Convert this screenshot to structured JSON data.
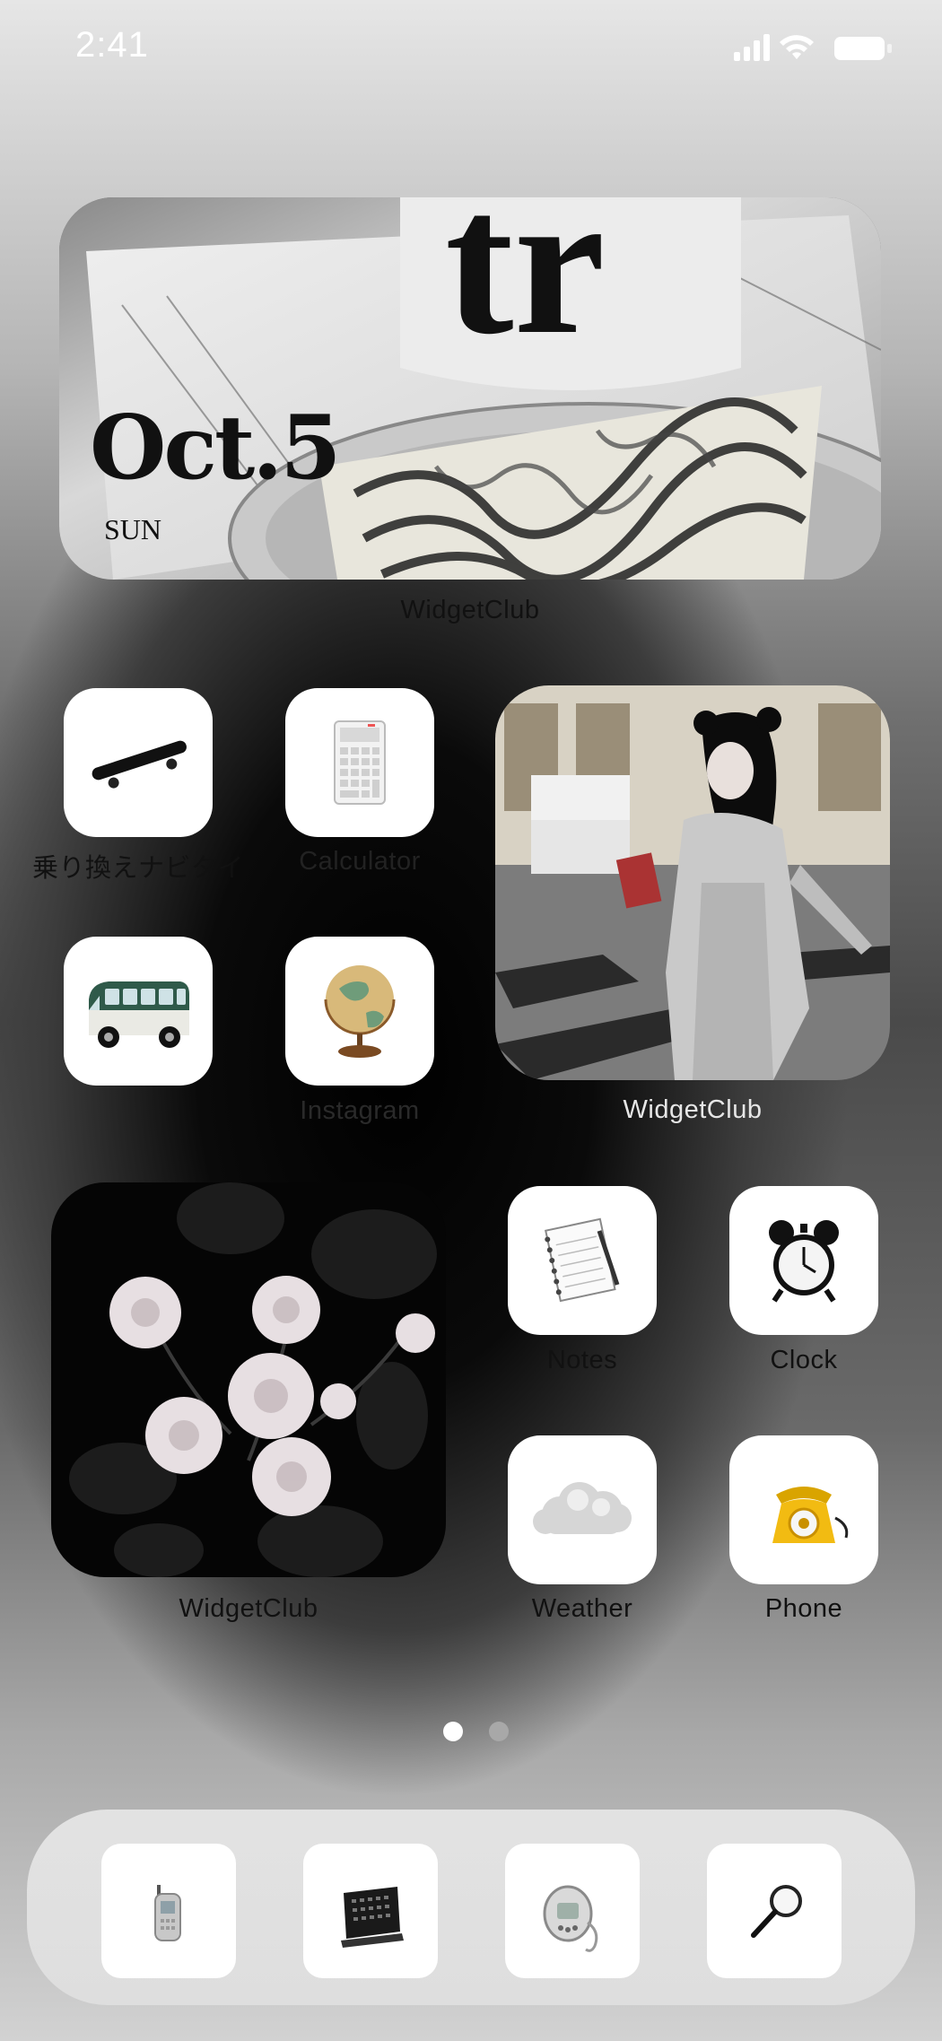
{
  "status_bar": {
    "time": "2:41"
  },
  "top_widget": {
    "date_text": "Oct.5",
    "weekday": "SUN",
    "cup_text": "tr",
    "label": "WidgetClub"
  },
  "apps": {
    "transit": {
      "label": "乗り換えナビタイ",
      "icon": "skateboard-icon"
    },
    "calculator": {
      "label": "Calculator",
      "icon": "calculator-icon"
    },
    "van": {
      "label": "",
      "icon": "van-icon"
    },
    "instagram": {
      "label": "Instagram",
      "icon": "globe-icon"
    },
    "notes": {
      "label": "Notes",
      "icon": "notebook-icon"
    },
    "clock": {
      "label": "Clock",
      "icon": "alarm-clock-icon"
    },
    "weather": {
      "label": "Weather",
      "icon": "cloud-icon"
    },
    "phone": {
      "label": "Phone",
      "icon": "rotary-phone-icon"
    }
  },
  "photo_widget_right": {
    "label": "WidgetClub"
  },
  "photo_widget_left": {
    "label": "WidgetClub"
  },
  "page_indicator": {
    "count": 2,
    "active": 1
  },
  "dock": {
    "items": [
      "flip-phone-icon",
      "desk-calendar-icon",
      "tamagotchi-icon",
      "magnifier-icon"
    ]
  },
  "colors": {
    "label_white": "#ffffff",
    "label_dark": "#111111"
  }
}
